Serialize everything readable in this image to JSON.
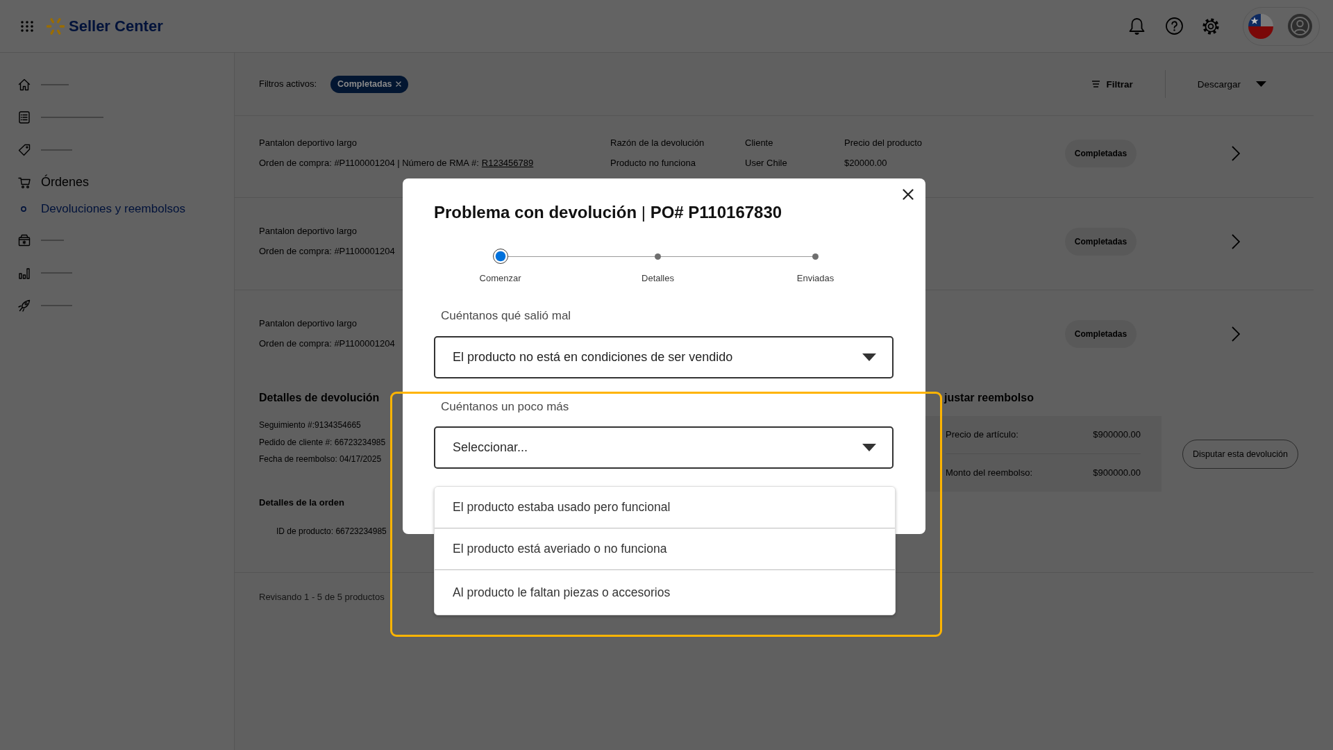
{
  "header": {
    "brand": "Seller Center"
  },
  "sidebar": {
    "items": [
      {
        "kind": "masked"
      },
      {
        "kind": "masked"
      },
      {
        "kind": "masked"
      },
      {
        "kind": "link",
        "label": "Órdenes",
        "children": [
          {
            "label": "Devoluciones y reembolsos",
            "selected": true
          }
        ]
      },
      {
        "kind": "masked"
      },
      {
        "kind": "masked"
      },
      {
        "kind": "masked"
      }
    ]
  },
  "filters": {
    "label": "Filtros activos:",
    "chips": [
      {
        "label": "Completadas"
      }
    ],
    "filter_button": "Filtrar",
    "download_button": "Descargar"
  },
  "returns": [
    {
      "product": "Pantalon deportivo largo",
      "order": "Orden de compra: #P1100001204 | Número de RMA #:",
      "rma": "R123456789",
      "columns": [
        {
          "label": "Razón de la devolución",
          "value": "Producto no funciona"
        },
        {
          "label": "Cliente",
          "value": "User Chile"
        },
        {
          "label": "Precio del producto",
          "value": "$20000.00"
        }
      ],
      "status": "Completadas"
    },
    {
      "product": "Pantalon deportivo largo",
      "order": "Orden de compra: #P1100001204",
      "status": "Completadas"
    },
    {
      "product": "Pantalon deportivo largo",
      "order": "Orden de compra: #P1100001204",
      "status": "Completadas"
    }
  ],
  "return_details": {
    "title": "Detalles de devolución",
    "lines": [
      "Seguimiento #:9134354665",
      "Pedido de cliente #: 66723234985",
      "Fecha de reembolso: 04/17/2025"
    ],
    "order_title": "Detalles de la orden",
    "order_lines": [
      "ID de producto: 66723234985"
    ]
  },
  "refund": {
    "title": "justar reembolso",
    "rows": [
      {
        "label": "Precio de artículo:",
        "value": "$900000.00"
      },
      {
        "label": "Monto del reembolso:",
        "value": "$900000.00"
      }
    ],
    "button": "Disputar esta devolución"
  },
  "pagination": "Revisando 1 - 5 de 5 productos",
  "dialog": {
    "title": "**Problema con devolución** | **PO# P110167830**",
    "steps": [
      {
        "label": "Comenzar",
        "selected": true
      },
      {
        "label": "Detalles",
        "selected": false
      },
      {
        "label": "Enviadas",
        "selected": false
      }
    ],
    "fields": [
      {
        "label": "Cuéntanos qué salió mal",
        "value": "El producto no está en condiciones de ser vendido",
        "highlighted": false
      },
      {
        "label": "Cuéntanos un poco más",
        "placeholder": "Seleccionar...",
        "expanded": true,
        "highlighted": true,
        "options": [
          {
            "label": "El producto estaba usado pero funcional",
            "selected": false
          },
          {
            "label": "El producto está averiado o no funciona",
            "selected": false
          },
          {
            "label": "Al producto le faltan piezas o accesorios",
            "selected": false
          }
        ]
      }
    ]
  }
}
